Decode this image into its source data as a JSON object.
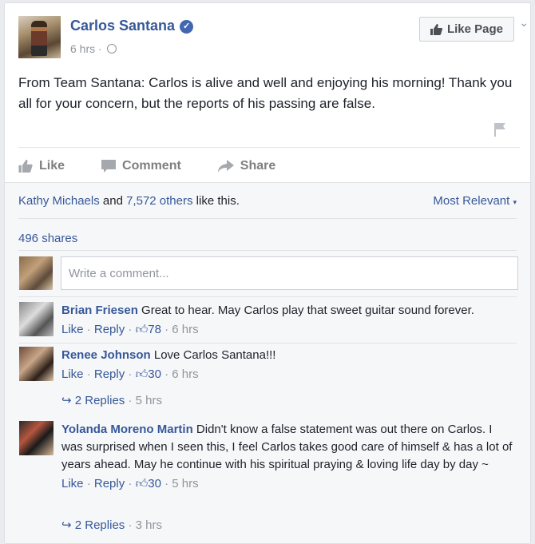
{
  "post": {
    "author": "Carlos Santana",
    "time": "6 hrs",
    "like_page_label": "Like Page",
    "text": "From Team Santana: Carlos is alive and well and enjoying his morning! Thank you all for your concern, but the reports of his passing are false."
  },
  "actions": {
    "like": "Like",
    "comment": "Comment",
    "share": "Share"
  },
  "reactions": {
    "name": "Kathy Michaels",
    "and": "and",
    "others": "7,572 others",
    "suffix": "like this.",
    "sort": "Most Relevant"
  },
  "shares": "496 shares",
  "composer": {
    "placeholder": "Write a comment..."
  },
  "comments": [
    {
      "name": "Brian Friesen",
      "text": "Great to hear. May Carlos play that sweet guitar sound forever.",
      "like": "Like",
      "reply": "Reply",
      "likes": "78",
      "time": "6 hrs"
    },
    {
      "name": "Renee Johnson",
      "text": "Love Carlos Santana!!!",
      "like": "Like",
      "reply": "Reply",
      "likes": "30",
      "time": "6 hrs",
      "replies": "2 Replies",
      "replies_time": "5 hrs"
    },
    {
      "name": "Yolanda Moreno Martin",
      "text": "Didn't know a false statement was out there on Carlos. I was surprised when I seen this, I feel Carlos takes good care of himself & has a lot of years ahead. May he continue with his spiritual praying & loving life day by day ~",
      "like": "Like",
      "reply": "Reply",
      "likes": "30",
      "time": "5 hrs",
      "replies": "2 Replies",
      "replies_time": "3 hrs"
    }
  ],
  "colors": {
    "link": "#365899",
    "muted": "#90949c",
    "text": "#1d2129",
    "verified": "#4267b2"
  },
  "icons": [
    "verified-badge-icon",
    "globe-icon",
    "thumbs-up-icon",
    "comment-icon",
    "share-arrow-icon",
    "flag-icon",
    "chevron-down-icon",
    "reply-arrow-icon"
  ]
}
